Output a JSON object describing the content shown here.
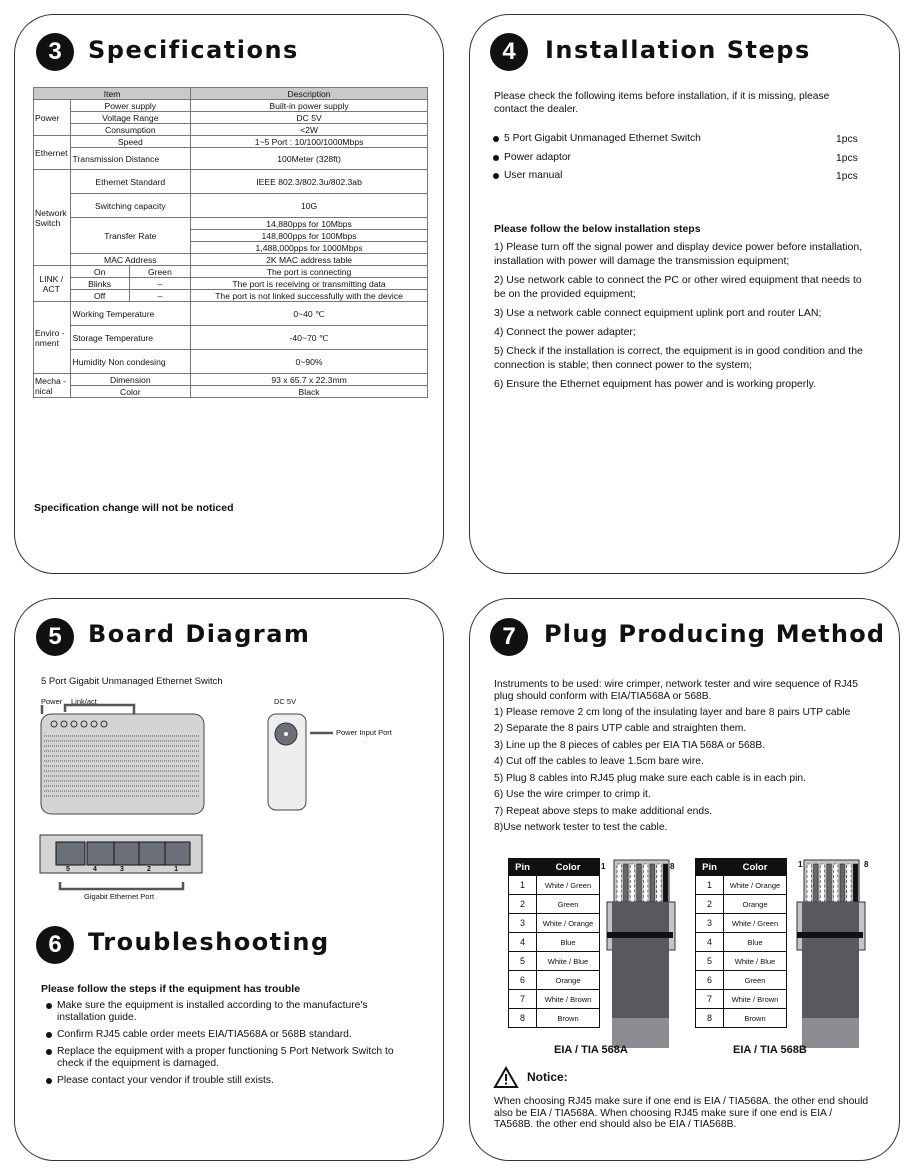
{
  "spec": {
    "number": "3",
    "title": "Specifications",
    "header": [
      "Item",
      "Description"
    ],
    "power": {
      "group": "Power",
      "rows": [
        [
          "Power supply",
          "Built-in power supply"
        ],
        [
          "Voltage Range",
          "DC 5V"
        ],
        [
          "Consumption",
          "<2W"
        ]
      ]
    },
    "ethernet": {
      "group": "Ethernet",
      "rows": [
        [
          "Speed",
          "1~5 Port : 10/100/1000Mbps"
        ],
        [
          "Transmission Distance",
          "100Meter (328ft)"
        ]
      ]
    },
    "network": {
      "group": "Network Switch",
      "standard": [
        "Ethernet Standard",
        "IEEE 802.3/802.3u/802.3ab"
      ],
      "capacity": [
        "Switching capacity",
        "10G"
      ],
      "transfer_label": "Transfer Rate",
      "transfer": [
        "14,880pps for 10Mbps",
        "148,800pps for 100Mbps",
        "1,488,000pps for 1000Mbps"
      ],
      "mac": [
        "MAC Address",
        "2K MAC address table"
      ]
    },
    "link": {
      "group": "LINK / ACT",
      "rows": [
        [
          "On",
          "Green",
          "The port is connecting"
        ],
        [
          "Blinks",
          "–",
          "The port is receiving or transmitting data"
        ],
        [
          "Off",
          "–",
          "The port is not linked successfully with the device"
        ]
      ]
    },
    "env": {
      "group": "Enviro -nment",
      "rows": [
        [
          "Working Temperature",
          "0~40 ℃"
        ],
        [
          "Storage Temperature",
          "-40~70 ℃"
        ],
        [
          "Humidity Non condesing",
          "0~90%"
        ]
      ]
    },
    "mech": {
      "group": "Mecha -nical",
      "rows": [
        [
          "Dimension",
          "93 x 65.7 x 22.3mm"
        ],
        [
          "Color",
          "Black"
        ]
      ]
    },
    "note": "Specification change will not be noticed"
  },
  "install": {
    "number": "4",
    "title": "Installation Steps",
    "intro": "Please check the following items before installation, if it is missing, please contact the dealer.",
    "items": [
      {
        "name": "5 Port Gigabit Unmanaged Ethernet Switch",
        "qty": "1pcs"
      },
      {
        "name": "Power adaptor",
        "qty": "1pcs"
      },
      {
        "name": "User manual",
        "qty": "1pcs"
      }
    ],
    "steps_heading": "Please follow the below installation steps",
    "steps": [
      "1) Please turn off the signal power and display device power before installation, installation with power will damage the transmission equipment;",
      "2) Use network cable to connect the PC or other wired equipment that needs to be on the provided equipment;",
      "3) Use a network cable connect equipment uplink port and router LAN;",
      "4) Connect the power adapter;",
      "5) Check if the installation is correct, the equipment is in good condition and the connection is stable; then connect power to the system;",
      "6) Ensure the Ethernet equipment has power and is working properly."
    ]
  },
  "board": {
    "number": "5",
    "title": "Board Diagram",
    "subtitle": "5 Port Gigabit Unmanaged Ethernet Switch",
    "power_label": "Power",
    "link_label": "Link/act",
    "dc_label": "DC 5V",
    "power_port_label": "Power Input Port",
    "ports": [
      "5",
      "4",
      "3",
      "2",
      "1"
    ],
    "ports_label": "Gigabit Ethernet Port"
  },
  "trouble": {
    "number": "6",
    "title": "Troubleshooting",
    "heading": "Please follow the steps if the equipment has trouble",
    "items": [
      "Make sure the equipment is installed according to the manufacture's installation guide.",
      "Confirm RJ45 cable order meets EIA/TIA568A or 568B standard.",
      "Replace the equipment with a proper functioning 5 Port Network Switch to check if the equipment  is  damaged.",
      "Please contact your vendor if trouble still exists."
    ]
  },
  "plug": {
    "number": "7",
    "title": "Plug Producing Method",
    "intro": "Instruments to be used: wire crimper, network tester and wire sequence of RJ45 plug should conform with EIA/TIA568A or 568B.",
    "steps": [
      "1) Please remove 2 cm long of the insulating layer and bare 8 pairs UTP cable",
      "2) Separate the 8 pairs UTP cable and straighten them.",
      "3) Line up the 8 pieces of cables per EIA TIA 568A or 568B.",
      "4) Cut off the cables to leave 1.5cm bare wire.",
      "5) Plug 8 cables into RJ45 plug make sure each cable is in each pin.",
      "6) Use the wire crimper to crimp it.",
      "7) Repeat above steps to make additional ends.",
      "8)Use network tester to test the cable."
    ],
    "table_header": [
      "Pin",
      "Color"
    ],
    "a": {
      "label": "EIA / TIA 568A",
      "colors": [
        "White / Green",
        "Green",
        "White / Orange",
        "Blue",
        "White / Blue",
        "Orange",
        "White / Brown",
        "Brown"
      ]
    },
    "b": {
      "label": "EIA / TIA 568B",
      "colors": [
        "White / Orange",
        "Orange",
        "White / Green",
        "Blue",
        "White / Blue",
        "Green",
        "White / Brown",
        "Brown"
      ]
    },
    "pins": [
      "1",
      "2",
      "3",
      "4",
      "5",
      "6",
      "7",
      "8"
    ],
    "pin_first": "1",
    "pin_last": "8",
    "notice_title": "Notice:",
    "notice": "When choosing RJ45 make sure if one end is EIA / TIA568A. the other end should also be EIA / TIA568A. When choosing RJ45 make sure if one end is EIA / TA568B. the other end should also be EIA / TIA568B."
  }
}
